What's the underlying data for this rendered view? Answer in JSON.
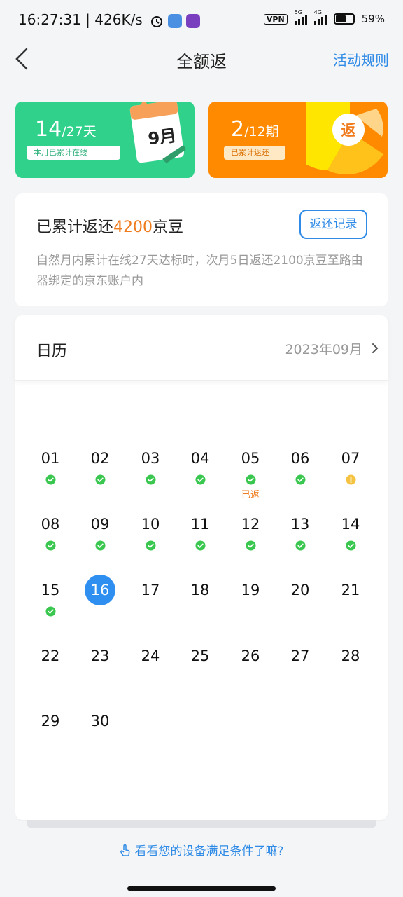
{
  "status_bar": {
    "time": "16:27:31 | 426K/s",
    "vpn": "VPN",
    "net1": "5G",
    "net2": "4G",
    "battery": "59%"
  },
  "header": {
    "title": "全额返",
    "rules": "活动规则"
  },
  "banners": {
    "online": {
      "count": "14",
      "total": "/27天",
      "tag": "本月已累计在线",
      "calendar_label": "9月"
    },
    "returned": {
      "count": "2",
      "total": "/12期",
      "tag": "已累计返还",
      "badge": "返"
    }
  },
  "summary": {
    "prefix": "已累计返还",
    "amount": "4200",
    "suffix": "京豆",
    "record_button": "返还记录",
    "description": "自然月内累计在线27天达标时，次月5日返还2100京豆至路由器绑定的京东账户内"
  },
  "calendar": {
    "title": "日历",
    "month": "2023年09月",
    "days": [
      {
        "d": "01",
        "status": "ok"
      },
      {
        "d": "02",
        "status": "ok"
      },
      {
        "d": "03",
        "status": "ok"
      },
      {
        "d": "04",
        "status": "ok"
      },
      {
        "d": "05",
        "status": "ok",
        "note": "已返"
      },
      {
        "d": "06",
        "status": "ok"
      },
      {
        "d": "07",
        "status": "warn"
      },
      {
        "d": "08",
        "status": "ok"
      },
      {
        "d": "09",
        "status": "ok"
      },
      {
        "d": "10",
        "status": "ok"
      },
      {
        "d": "11",
        "status": "ok"
      },
      {
        "d": "12",
        "status": "ok"
      },
      {
        "d": "13",
        "status": "ok"
      },
      {
        "d": "14",
        "status": "ok"
      },
      {
        "d": "15",
        "status": "ok"
      },
      {
        "d": "16",
        "status": "today"
      },
      {
        "d": "17"
      },
      {
        "d": "18"
      },
      {
        "d": "19"
      },
      {
        "d": "20"
      },
      {
        "d": "21"
      },
      {
        "d": "22"
      },
      {
        "d": "23"
      },
      {
        "d": "24"
      },
      {
        "d": "25"
      },
      {
        "d": "26"
      },
      {
        "d": "27"
      },
      {
        "d": "28"
      },
      {
        "d": "29"
      },
      {
        "d": "30"
      }
    ]
  },
  "hint": "看看您的设备满足条件了嘛?",
  "colors": {
    "accent_blue": "#2f8be6",
    "green": "#2fd18b",
    "orange": "#ff8a00",
    "check": "#3ac74f",
    "warn": "#f5c342",
    "highlight": "#f07b1d"
  }
}
